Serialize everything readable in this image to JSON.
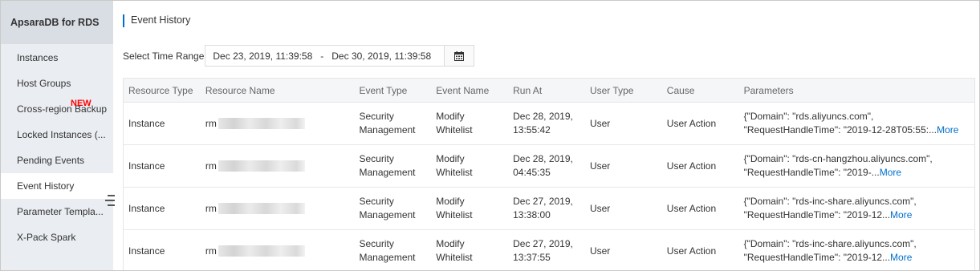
{
  "sidebar": {
    "title": "ApsaraDB for RDS",
    "items": [
      {
        "label": "Instances"
      },
      {
        "label": "Host Groups"
      },
      {
        "label": "Cross-region Backup",
        "badge": "NEW"
      },
      {
        "label": "Locked Instances (..."
      },
      {
        "label": "Pending Events"
      },
      {
        "label": "Event History",
        "active": true
      },
      {
        "label": "Parameter Templa..."
      },
      {
        "label": "X-Pack Spark"
      }
    ]
  },
  "page": {
    "title": "Event History"
  },
  "filter": {
    "label": "Select Time Range",
    "start": "Dec 23, 2019, 11:39:58",
    "separator": "-",
    "end": "Dec 30, 2019, 11:39:58",
    "calendar_icon": "calendar-icon"
  },
  "table": {
    "headers": [
      "Resource Type",
      "Resource Name",
      "Event Type",
      "Event Name",
      "Run At",
      "User Type",
      "Cause",
      "Parameters"
    ],
    "rows": [
      {
        "resource_type": "Instance",
        "resource_name_prefix": "rm",
        "event_type_1": "Security",
        "event_type_2": "Management",
        "event_name_1": "Modify",
        "event_name_2": "Whitelist",
        "run_at_1": "Dec 28, 2019,",
        "run_at_2": "13:55:42",
        "user_type": "User",
        "cause": "User Action",
        "params_1": "{\"Domain\": \"rds.aliyuncs.com\",",
        "params_2": "\"RequestHandleTime\": \"2019-12-28T05:55:...",
        "more": "More"
      },
      {
        "resource_type": "Instance",
        "resource_name_prefix": "rm",
        "event_type_1": "Security",
        "event_type_2": "Management",
        "event_name_1": "Modify",
        "event_name_2": "Whitelist",
        "run_at_1": "Dec 28, 2019,",
        "run_at_2": "04:45:35",
        "user_type": "User",
        "cause": "User Action",
        "params_1": "{\"Domain\": \"rds-cn-hangzhou.aliyuncs.com\",",
        "params_2": "\"RequestHandleTime\": \"2019-...",
        "more": "More"
      },
      {
        "resource_type": "Instance",
        "resource_name_prefix": "rm",
        "event_type_1": "Security",
        "event_type_2": "Management",
        "event_name_1": "Modify",
        "event_name_2": "Whitelist",
        "run_at_1": "Dec 27, 2019,",
        "run_at_2": "13:38:00",
        "user_type": "User",
        "cause": "User Action",
        "params_1": "{\"Domain\": \"rds-inc-share.aliyuncs.com\",",
        "params_2": "\"RequestHandleTime\": \"2019-12...",
        "more": "More"
      },
      {
        "resource_type": "Instance",
        "resource_name_prefix": "rm",
        "event_type_1": "Security",
        "event_type_2": "Management",
        "event_name_1": "Modify",
        "event_name_2": "Whitelist",
        "run_at_1": "Dec 27, 2019,",
        "run_at_2": "13:37:55",
        "user_type": "User",
        "cause": "User Action",
        "params_1": "{\"Domain\": \"rds-inc-share.aliyuncs.com\",",
        "params_2": "\"RequestHandleTime\": \"2019-12...",
        "more": "More"
      }
    ]
  },
  "colors": {
    "accent": "#0070cc",
    "badge": "#ff0000",
    "sidebar_bg": "#eaedf1",
    "sidebar_title_bg": "#d9dee4"
  },
  "icons": {
    "collapse": "collapse-menu-icon",
    "calendar": "calendar-icon"
  }
}
